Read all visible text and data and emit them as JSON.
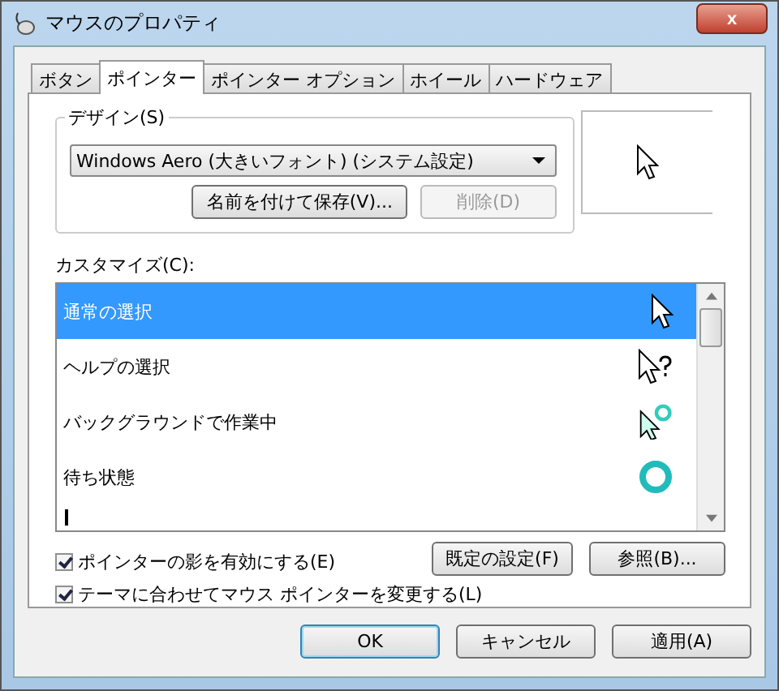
{
  "window": {
    "title": "マウスのプロパティ",
    "close": "x"
  },
  "tabs": [
    {
      "label": "ボタン",
      "selected": false
    },
    {
      "label": "ポインター",
      "selected": true
    },
    {
      "label": "ポインター オプション",
      "selected": false
    },
    {
      "label": "ホイール",
      "selected": false
    },
    {
      "label": "ハードウェア",
      "selected": false
    }
  ],
  "design": {
    "label": "デザイン(S)",
    "scheme": "Windows Aero (大きいフォント) (システム設定)",
    "save_button": "名前を付けて保存(V)...",
    "delete_button": {
      "label": "削除(D)",
      "disabled": true
    }
  },
  "customize": {
    "label": "カスタマイズ(C):",
    "rows": [
      {
        "label": "通常の選択",
        "kind": "arrow",
        "selected": true
      },
      {
        "label": "ヘルプの選択",
        "kind": "help",
        "selected": false
      },
      {
        "label": "バックグラウンドで作業中",
        "kind": "working",
        "selected": false
      },
      {
        "label": "待ち状態",
        "kind": "busy",
        "selected": false
      },
      {
        "kind": "text",
        "selected": false
      }
    ]
  },
  "options": [
    {
      "label": "ポインターの影を有効にする(E)",
      "checked": true
    },
    {
      "label": "テーマに合わせてマウス ポインターを変更する(L)",
      "checked": true
    }
  ],
  "side_buttons": [
    "既定の設定(F)",
    "参照(B)..."
  ],
  "buttons": [
    {
      "label": "OK",
      "default": true
    },
    {
      "label": "キャンセル",
      "default": false
    },
    {
      "label": "適用(A)",
      "default": false
    }
  ]
}
